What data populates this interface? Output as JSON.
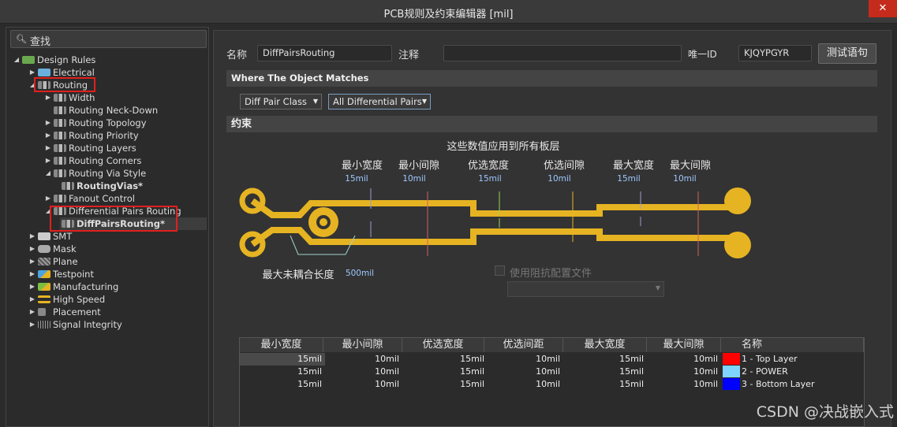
{
  "window": {
    "title": "PCB规则及约束编辑器 [mil]",
    "close_label": "✕"
  },
  "search": {
    "icon": "search-icon",
    "label": "查找"
  },
  "tree": {
    "root": "Design Rules",
    "electrical": "Electrical",
    "routing": "Routing",
    "width": "Width",
    "neckdown": "Routing Neck-Down",
    "topology": "Routing Topology",
    "priority": "Routing Priority",
    "layers": "Routing Layers",
    "corners": "Routing Corners",
    "viastyle": "Routing Via Style",
    "routingvias": "RoutingVias*",
    "fanout": "Fanout Control",
    "diffpairs": "Differential Pairs Routing",
    "diffpairsrouting": "DiffPairsRouting*",
    "smt": "SMT",
    "mask": "Mask",
    "plane": "Plane",
    "testpoint": "Testpoint",
    "manufacturing": "Manufacturing",
    "highspeed": "High Speed",
    "placement": "Placement",
    "signal": "Signal Integrity"
  },
  "form": {
    "name_label": "名称",
    "name_value": "DiffPairsRouting",
    "comment_label": "注释",
    "comment_value": "",
    "uid_label": "唯一ID",
    "uid_value": "KJQYPGYR",
    "test_button": "测试语句"
  },
  "match": {
    "header": "Where The Object Matches",
    "type_value": "Diff Pair Class",
    "class_value": "All Differential Pairs"
  },
  "constraints": {
    "header": "约束",
    "note": "这些数值应用到所有板层",
    "labels": [
      "最小宽度",
      "最小间隙",
      "优选宽度",
      "优选间隙",
      "最大宽度",
      "最大间隙"
    ],
    "values": [
      "15mil",
      "10mil",
      "15mil",
      "10mil",
      "15mil",
      "10mil"
    ],
    "uncoupled_label": "最大未耦合长度",
    "uncoupled_value": "500mil",
    "impedance_label": "使用阻抗配置文件",
    "trace_color": "#e6b422"
  },
  "table": {
    "headers": [
      "最小宽度",
      "最小间隙",
      "优选宽度",
      "优选间距",
      "最大宽度",
      "最大间隙",
      "名称"
    ],
    "rows": [
      {
        "v": [
          "15mil",
          "10mil",
          "15mil",
          "10mil",
          "15mil",
          "10mil"
        ],
        "color": "#ff0000",
        "name": "1 - Top Layer"
      },
      {
        "v": [
          "15mil",
          "10mil",
          "15mil",
          "10mil",
          "15mil",
          "10mil"
        ],
        "color": "#7fd4ff",
        "name": "2 - POWER"
      },
      {
        "v": [
          "15mil",
          "10mil",
          "15mil",
          "10mil",
          "15mil",
          "10mil"
        ],
        "color": "#0000ff",
        "name": "3 - Bottom Layer"
      }
    ]
  },
  "watermark": "CSDN @决战嵌入式"
}
